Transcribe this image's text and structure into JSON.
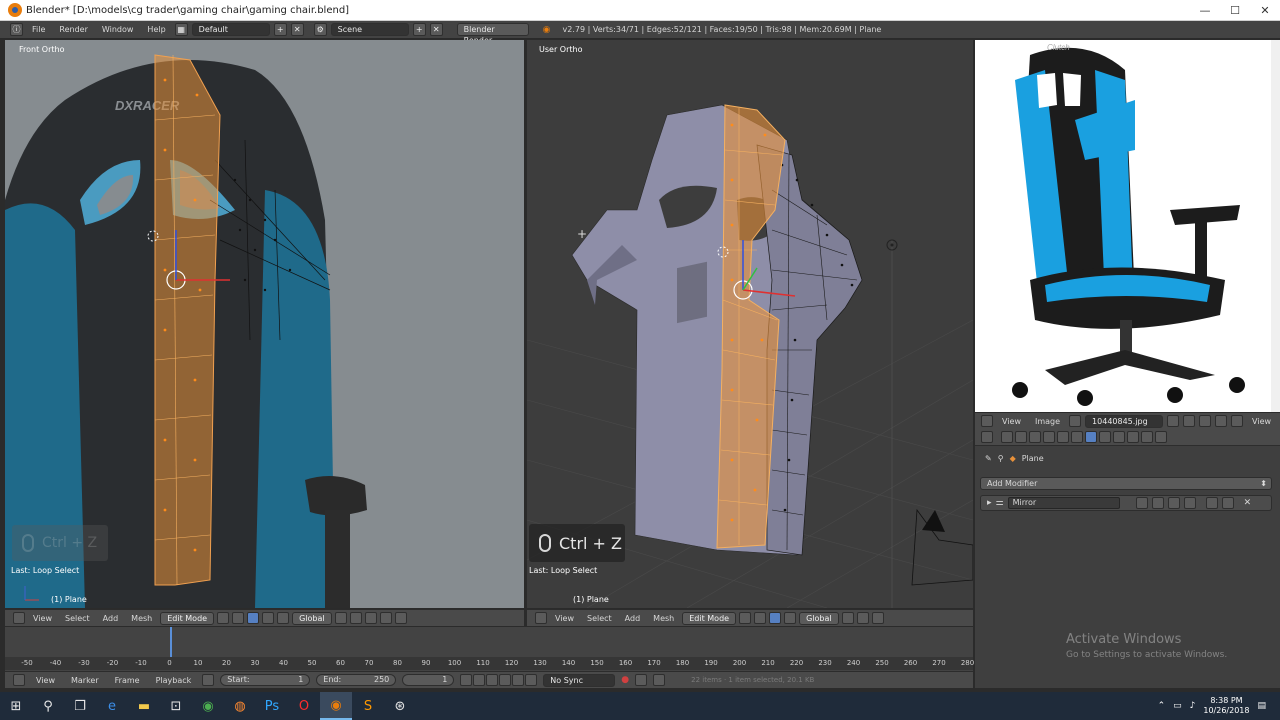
{
  "window": {
    "title": "Blender* [D:\\models\\cg trader\\gaming chair\\gaming chair.blend]",
    "min": "—",
    "max": "☐",
    "close": "✕"
  },
  "info_header": {
    "menus": [
      "File",
      "Render",
      "Window",
      "Help"
    ],
    "layout": "Default",
    "scene": "Scene",
    "engine": "Blender Render",
    "stats": "v2.79 | Verts:34/71 | Edges:52/121 | Faces:19/50 | Tris:98 | Mem:20.69M | Plane"
  },
  "left_viewport": {
    "label": "Front Ortho",
    "last_op": "Last: Loop Select",
    "object": "(1) Plane",
    "ghost_hint": "Ctrl + Z",
    "brand_text": "DXRACER",
    "header": {
      "menus": [
        "View",
        "Select",
        "Add",
        "Mesh"
      ],
      "mode": "Edit Mode",
      "orientation": "Global"
    }
  },
  "right_viewport": {
    "label": "User Ortho",
    "last_op": "Last: Loop Select",
    "object": "(1) Plane",
    "hint": "Ctrl + Z",
    "header": {
      "menus": [
        "View",
        "Select",
        "Add",
        "Mesh"
      ],
      "mode": "Edit Mode",
      "orientation": "Global"
    }
  },
  "image_editor": {
    "brand_text": "Clutch",
    "menus": [
      "View",
      "Image"
    ],
    "image_name": "10440845.jpg",
    "view_label": "View"
  },
  "properties": {
    "object": "Plane",
    "add_modifier": "Add Modifier",
    "modifier_name": "Mirror"
  },
  "timeline": {
    "ticks": [
      "-50",
      "-40",
      "-30",
      "-20",
      "-10",
      "0",
      "10",
      "20",
      "30",
      "40",
      "50",
      "60",
      "70",
      "80",
      "90",
      "100",
      "110",
      "120",
      "130",
      "140",
      "150",
      "160",
      "170",
      "180",
      "190",
      "200",
      "210",
      "220",
      "230",
      "240",
      "250",
      "260",
      "270",
      "280"
    ],
    "menus": [
      "View",
      "Marker",
      "Frame",
      "Playback"
    ],
    "start_label": "Start:",
    "start": "1",
    "end_label": "End:",
    "end": "250",
    "current": "1",
    "sync": "No Sync",
    "status": "22 items · 1 item selected, 20.1 KB"
  },
  "watermark": {
    "title": "Activate Windows",
    "subtitle": "Go to Settings to activate Windows."
  },
  "taskbar": {
    "time": "8:38 PM",
    "date": "10/26/2018"
  },
  "colors": {
    "selection": "#e8913a",
    "mesh_face": "#8e8ea8",
    "accent_blue": "#5680c2"
  }
}
